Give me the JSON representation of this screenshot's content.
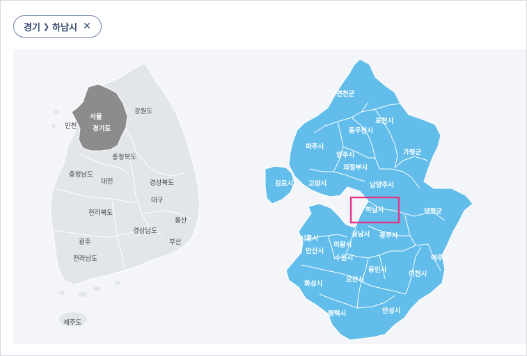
{
  "breadcrumb": {
    "province": "경기",
    "separator_icon": "chevron-right-icon",
    "city": "하남시",
    "close_icon": "close-icon"
  },
  "colors": {
    "korea_land": "#e2e5ea",
    "korea_selected": "#8c8c8c",
    "gyeonggi_fill": "#62bdea",
    "gyeonggi_border": "#ffffff",
    "highlight": "#e0398a",
    "background": "#f4f5f8"
  },
  "korea_map": {
    "selected_region": "경기도",
    "regions": {
      "incheon": "인천",
      "seoul": "서울",
      "gyeonggi": "경기도",
      "gangwon": "강원도",
      "chungbuk": "충청북도",
      "chungnam": "충청남도",
      "daejeon": "대전",
      "gyeongbuk": "경상북도",
      "daegu": "대구",
      "jeonbuk": "전라북도",
      "ulsan": "울산",
      "gyeongnam": "경상남도",
      "gwangju": "광주",
      "busan": "부산",
      "jeonnam": "전라남도",
      "jeju": "제주도"
    }
  },
  "gyeonggi_map": {
    "selected_city": "하남시",
    "cities": {
      "yeoncheon": "연천군",
      "pocheon": "포천시",
      "dongducheon": "동두천시",
      "paju": "파주시",
      "yangju": "양주시",
      "gapyeong": "가평군",
      "uijeongbu": "의정부시",
      "gimpo": "김포시",
      "goyang": "고양시",
      "namyangju": "남양주시",
      "hanam": "하남시",
      "yangpyeong": "양평군",
      "siheung": "시흥시",
      "seongnam": "성남시",
      "gwangju": "광주시",
      "uiwang": "의왕시",
      "ansan": "안산시",
      "suwon": "수원시",
      "yeoju": "여주시",
      "yongin": "용인시",
      "icheon": "이천시",
      "hwaseong": "화성시",
      "osan": "오산시",
      "pyeongtaek": "평택시",
      "anseong": "안성시"
    }
  }
}
